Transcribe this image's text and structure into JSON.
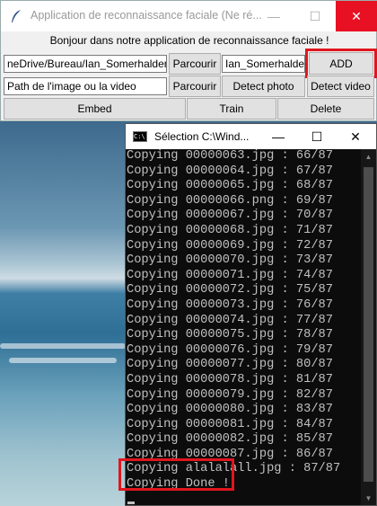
{
  "app": {
    "title": "Application de reconnaissance faciale (Ne ré...",
    "greeting": "Bonjour dans notre application de reconnaissance faciale !",
    "folder_path_value": "neDrive/Bureau/Ian_Somerhalder",
    "browse_label_1": "Parcourir",
    "name_value": "Ian_Somerhalder",
    "add_label": "ADD",
    "media_path_value": "Path de l'image ou la video",
    "browse_label_2": "Parcourir",
    "detect_photo_label": "Detect photo",
    "detect_video_label": "Detect video",
    "embed_label": "Embed",
    "train_label": "Train",
    "delete_label": "Delete",
    "controls": {
      "minimize": "—",
      "maximize": "☐",
      "close": "✕"
    }
  },
  "console": {
    "icon_text": "C:\\",
    "title": "Sélection C:\\Wind...",
    "controls": {
      "minimize": "—",
      "maximize": "☐",
      "close": "✕"
    },
    "lines": [
      "Copying 00000063.jpg : 66/87",
      "Copying 00000064.jpg : 67/87",
      "Copying 00000065.jpg : 68/87",
      "Copying 00000066.png : 69/87",
      "Copying 00000067.jpg : 70/87",
      "Copying 00000068.jpg : 71/87",
      "Copying 00000069.jpg : 72/87",
      "Copying 00000070.jpg : 73/87",
      "Copying 00000071.jpg : 74/87",
      "Copying 00000072.jpg : 75/87",
      "Copying 00000073.jpg : 76/87",
      "Copying 00000074.jpg : 77/87",
      "Copying 00000075.jpg : 78/87",
      "Copying 00000076.jpg : 79/87",
      "Copying 00000077.jpg : 80/87",
      "Copying 00000078.jpg : 81/87",
      "Copying 00000079.jpg : 82/87",
      "Copying 00000080.jpg : 83/87",
      "Copying 00000081.jpg : 84/87",
      "Copying 00000082.jpg : 85/87",
      "Copying 00000087.jpg : 86/87",
      "Copying alalalall.jpg : 87/87",
      "Copying Done !"
    ]
  },
  "colors": {
    "highlight": "#e0161e",
    "close_red": "#e81123",
    "console_bg": "#0c0c0c",
    "console_text": "#c0c0c0"
  },
  "icons": {
    "app_icon": "feather-icon",
    "console_icon": "cmd-icon"
  }
}
